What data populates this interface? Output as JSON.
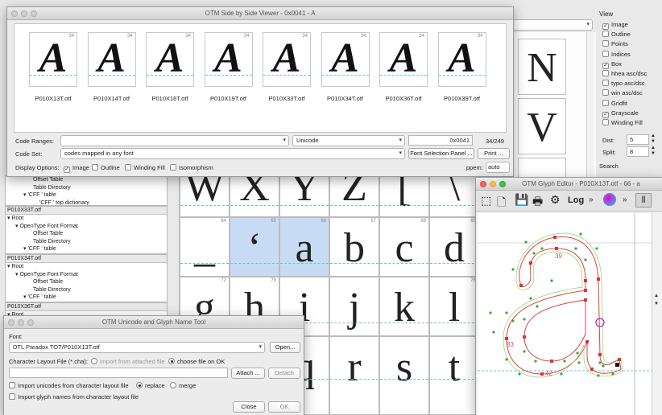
{
  "right_panel": {
    "view_label": "View",
    "options": [
      {
        "label": "Image",
        "checked": true
      },
      {
        "label": "Outline",
        "checked": false
      },
      {
        "label": "Points",
        "checked": false
      },
      {
        "label": "Indices",
        "checked": false
      },
      {
        "label": "Box",
        "checked": true
      },
      {
        "label": "hhea asc/dsc",
        "checked": false
      },
      {
        "label": "typo asc/dsc",
        "checked": false
      },
      {
        "label": "win asc/dsc",
        "checked": false
      },
      {
        "label": "Gridfit",
        "checked": false
      },
      {
        "label": "Grayscale",
        "checked": true
      },
      {
        "label": "Winding Fill",
        "checked": false
      }
    ],
    "dist_label": "Dist:",
    "dist_value": "5",
    "split_label": "Split:",
    "split_value": "8",
    "search_label": "Search"
  },
  "background_grid": {
    "top_row_glyphs": [
      "N",
      "V"
    ],
    "row_w": [
      "W",
      "X",
      "Y",
      "Z",
      "[",
      "\\"
    ],
    "row_a": {
      "numbers": [
        "64",
        "65",
        "66",
        "67",
        "68",
        "69"
      ],
      "glyphs": [
        "_",
        "‘",
        "a",
        "b",
        "c",
        "d"
      ]
    },
    "row_g": {
      "numbers": [
        "72",
        "73",
        "",
        "",
        "",
        "76"
      ],
      "glyphs": [
        "g",
        "h",
        "i",
        "j",
        "k",
        "l"
      ]
    },
    "row_q": {
      "glyphs": [
        "p",
        "q",
        "r",
        "s",
        "t"
      ]
    }
  },
  "tree_panes": [
    {
      "header": "",
      "lines": [
        "Offset Table",
        "Table Directory",
        "'CFF ' table",
        "'CFF ' top dictionary"
      ]
    },
    {
      "header": "P010X33T.otf",
      "lines": [
        "Root",
        "OpenType Font Format",
        "Offset Table",
        "Table Directory",
        "'CFF ' table",
        "'CFF ' top dictionary"
      ]
    },
    {
      "header": "P010X34T.otf",
      "lines": [
        "Root",
        "OpenType Font Format",
        "Offset Table",
        "Table Directory",
        "'CFF ' table",
        "'CFF ' top dictionary"
      ]
    },
    {
      "header": "P010X36T.otf",
      "lines": [
        "Root"
      ]
    }
  ],
  "side_by_side": {
    "title": "OTM Side by Side Viewer - 0x0041 - A",
    "number": "34",
    "glyph": "A",
    "fonts": [
      "P010X13T.otf",
      "P010X14T.otf",
      "P010X16T.otf",
      "P010X19T.otf",
      "P010X33T.otf",
      "P010X34T.otf",
      "P010X36T.otf",
      "P010X39T.otf"
    ],
    "code_ranges_label": "Code Ranges:",
    "code_ranges_value": "",
    "encoding": "Unicode",
    "code_value": "0x0041",
    "count": "34/249",
    "code_set_label": "Code Set:",
    "code_set_value": "codes mapped in any font",
    "font_selection_button": "Font Selection Panel ...",
    "print_button": "Print ...",
    "display_options_label": "Display Options:",
    "display_options": [
      {
        "label": "Image",
        "checked": true
      },
      {
        "label": "Outline",
        "checked": false
      },
      {
        "label": "Winding Fill",
        "checked": false
      },
      {
        "label": "Isomorphism",
        "checked": false
      }
    ],
    "ppem_label": "ppem:",
    "ppem_value": "auto"
  },
  "unicode_tool": {
    "title": "OTM Unicode and Glyph Name Tool",
    "font_label": "Font:",
    "font_value": "DTL Paradox TOT/P010X13T.otf",
    "open_button": "Open...",
    "layout_label": "Character Layout File (*.cha):",
    "import_attached": "import from attached file",
    "choose_file": "choose file on OK",
    "attach_button": "Attach ...",
    "detach_button": "Detach",
    "import_unicodes": "Import unicodes from character layout file",
    "replace": "replace",
    "merge": "merge",
    "import_names": "Import glyph names from character layout file",
    "close_button": "Close",
    "ok_button": "OK"
  },
  "glyph_editor": {
    "title": "OTM Glyph Editor - P010X13T.otf - 66 - a",
    "toolbar": [
      "new-icon",
      "document-icon",
      "save-icon",
      "print-icon",
      "tools-icon",
      "Log",
      "»",
      "color-icon",
      "»",
      "grid-icon"
    ],
    "log_label": "Log",
    "more_label": "»",
    "point_labels": [
      "39",
      "83",
      "42"
    ]
  }
}
